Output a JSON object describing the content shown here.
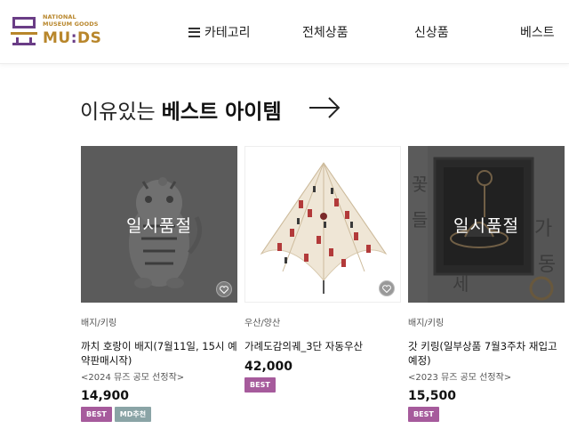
{
  "header": {
    "logo": {
      "small_line1": "NATIONAL",
      "small_line2": "MUSEUM GOODS",
      "brand_part1": "MU",
      "brand_part2": ":",
      "brand_part3": "DS"
    },
    "nav": {
      "category_label": "카테고리",
      "all_products_label": "전체상품",
      "new_label": "신상품",
      "best_label": "베스트"
    }
  },
  "section": {
    "title_light": "이유있는",
    "title_bold": "베스트 아이템"
  },
  "products": [
    {
      "soldout_text": "일시품절",
      "category": "배지/키링",
      "name": "까치 호랑이 배지(7월11일, 15시 예약판매시작)",
      "contest": "<2024 뮤즈 공모 선정작>",
      "price": "14,900",
      "badges": [
        "BEST",
        "MD추천"
      ]
    },
    {
      "category": "우산/양산",
      "name": "가례도감의궤_3단 자동우산",
      "price": "42,000",
      "badges": [
        "BEST"
      ]
    },
    {
      "soldout_text": "일시품절",
      "category": "배지/키링",
      "name": "갓 키링(일부상품 7월3주차 재입고 예정)",
      "contest": "<2023 뮤즈 공모 선정작>",
      "price": "15,500",
      "badges": [
        "BEST"
      ]
    }
  ],
  "colors": {
    "logo_gold": "#b8862b",
    "logo_purple": "#6a3d86",
    "badge_best": "#a65b9c",
    "badge_md": "#8aa4a6"
  }
}
